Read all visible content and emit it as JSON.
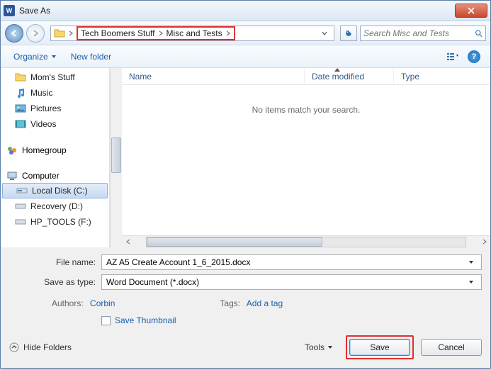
{
  "window": {
    "title": "Save As"
  },
  "nav": {
    "path": [
      "Tech Boomers Stuff",
      "Misc and Tests"
    ],
    "search_placeholder": "Search Misc and Tests"
  },
  "toolbar": {
    "organize": "Organize",
    "new_folder": "New folder"
  },
  "sidebar": {
    "favorites": [
      {
        "label": "Mom's Stuff",
        "icon": "folder"
      },
      {
        "label": "Music",
        "icon": "music"
      },
      {
        "label": "Pictures",
        "icon": "pictures"
      },
      {
        "label": "Videos",
        "icon": "videos"
      }
    ],
    "homegroup": "Homegroup",
    "computer": "Computer",
    "drives": [
      {
        "label": "Local Disk (C:)",
        "selected": true
      },
      {
        "label": "Recovery (D:)",
        "selected": false
      },
      {
        "label": "HP_TOOLS (F:)",
        "selected": false
      }
    ]
  },
  "columns": {
    "name": "Name",
    "date": "Date modified",
    "type": "Type"
  },
  "main": {
    "empty": "No items match your search."
  },
  "form": {
    "filename_label": "File name:",
    "filename_value": "AZ A5 Create Account 1_6_2015.docx",
    "savetype_label": "Save as type:",
    "savetype_value": "Word Document (*.docx)",
    "authors_label": "Authors:",
    "authors_value": "Corbin",
    "tags_label": "Tags:",
    "tags_value": "Add a tag",
    "save_thumb": "Save Thumbnail"
  },
  "footer": {
    "hide_folders": "Hide Folders",
    "tools": "Tools",
    "save": "Save",
    "cancel": "Cancel"
  }
}
